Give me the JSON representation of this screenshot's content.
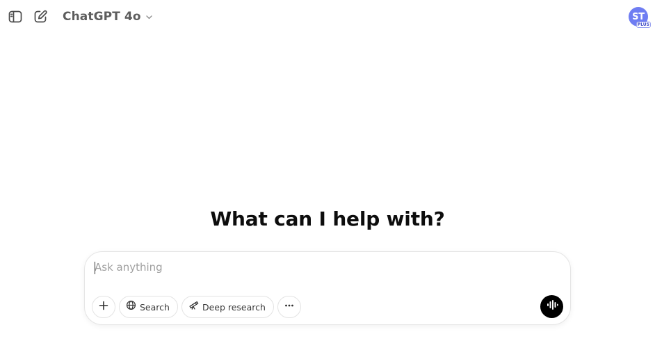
{
  "header": {
    "model_name": "ChatGPT 4o",
    "avatar_initials": "ST",
    "avatar_badge": "PLUS"
  },
  "main": {
    "heading": "What can I help with?"
  },
  "composer": {
    "placeholder": "Ask anything",
    "value": "",
    "tools": {
      "search_label": "Search",
      "deep_research_label": "Deep research"
    }
  },
  "colors": {
    "avatar_bg": "#6f7df2",
    "voice_button_bg": "#000000",
    "text_primary": "#0d0d0d",
    "text_secondary": "#5d5d5d"
  },
  "icons": {
    "sidebar_toggle": "sidebar-toggle-icon",
    "new_chat": "new-chat-icon",
    "model_chevron": "chevron-down-icon",
    "add": "plus-icon",
    "search": "globe-icon",
    "deep_research": "telescope-icon",
    "more": "ellipsis-icon",
    "voice": "voice-waveform-icon"
  }
}
